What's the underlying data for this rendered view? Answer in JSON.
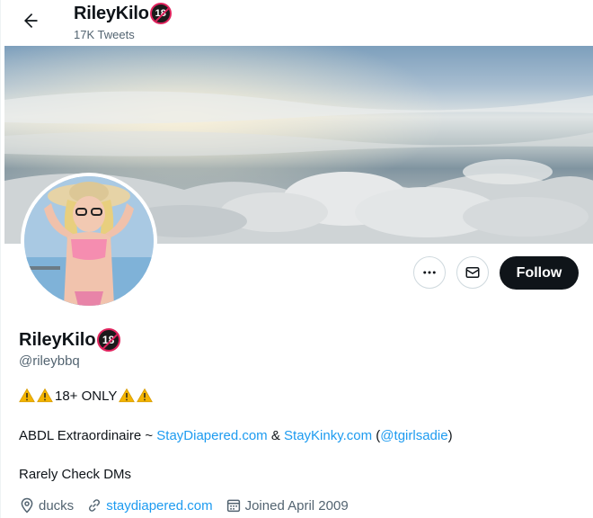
{
  "header": {
    "name": "RileyKilo",
    "badge_text": "18",
    "tweet_count": "17K Tweets"
  },
  "actions": {
    "follow_label": "Follow"
  },
  "profile": {
    "display_name": "RileyKilo",
    "badge_text": "18",
    "handle": "@rileybbq",
    "bio": {
      "line1_text": "18+ ONLY",
      "line2_prefix": "ABDL Extraordinaire ~ ",
      "line2_link1": "StayDiapered.com",
      "line2_mid": " & ",
      "line2_link2": "StayKinky.com",
      "line2_open": " (",
      "line2_mention": "@tgirlsadie",
      "line2_close": ")",
      "line3": "Rarely Check DMs"
    },
    "meta": {
      "location": "ducks",
      "website": "staydiapered.com",
      "joined": "Joined April 2009"
    }
  },
  "colors": {
    "accent": "#1d9bf0",
    "text_primary": "#0f1419",
    "text_secondary": "#536471",
    "badge_red": "#e0245e",
    "follow_bg": "#0f1419"
  },
  "icons": {
    "back": "arrow-left-icon",
    "more": "more-horizontal-icon",
    "message": "envelope-icon",
    "location": "location-pin-icon",
    "link": "link-icon",
    "calendar": "calendar-icon",
    "warning": "warning-icon"
  }
}
